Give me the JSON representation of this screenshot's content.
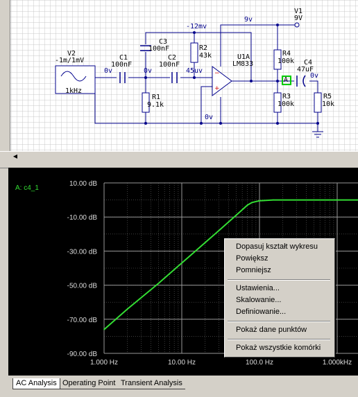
{
  "schematic": {
    "nets": {
      "minus12": "-12mv",
      "nine": "9v",
      "zero_a": "0v",
      "zero_b": "0v",
      "zero_c": "0v",
      "u45": "45uv",
      "zero_d": "0v",
      "zero_e": "0v"
    },
    "components": {
      "v1": {
        "name": "V1",
        "value": "9V"
      },
      "v2": {
        "name": "V2",
        "value": "-1m/1mV",
        "freq": "1kHz"
      },
      "c1": {
        "name": "C1",
        "value": "100nF"
      },
      "c2": {
        "name": "C2",
        "value": "100nF"
      },
      "c3": {
        "name": "C3",
        "value": "100nF"
      },
      "c4": {
        "name": "C4",
        "value": "47uF"
      },
      "r1": {
        "name": "R1",
        "value": "9.1k"
      },
      "r2": {
        "name": "R2",
        "value": "43k"
      },
      "r3": {
        "name": "R3",
        "value": "100k"
      },
      "r4": {
        "name": "R4",
        "value": "100k"
      },
      "r5": {
        "name": "R5",
        "value": "10k"
      },
      "u1": {
        "name": "U1A",
        "value": "LM833"
      },
      "probe": "A"
    }
  },
  "chart": {
    "trace_label": "A: c4_1",
    "colors": {
      "trace": "#33dd33",
      "axis_text": "#dddddd",
      "grid": "#666666",
      "background": "#000000"
    }
  },
  "chart_data": {
    "type": "line",
    "title": "",
    "xlabel": "",
    "ylabel": "",
    "xscale": "log",
    "xlim": [
      1,
      1000
    ],
    "ylim": [
      -90,
      10
    ],
    "x_tick_labels": [
      "1.000 Hz",
      "10.00 Hz",
      "100.0 Hz",
      "1.000kHz"
    ],
    "y_tick_labels": [
      "10.00 dB",
      "-10.00 dB",
      "-30.00 dB",
      "-50.00 dB",
      "-70.00 dB",
      "-90.00 dB"
    ],
    "series": [
      {
        "name": "A: c4_1",
        "x": [
          1,
          2,
          5,
          10,
          20,
          30,
          50,
          70,
          80,
          100,
          150,
          200,
          500,
          1000
        ],
        "y": [
          -76,
          -64,
          -49,
          -37,
          -25,
          -18,
          -9,
          -3,
          -1.5,
          -0.5,
          0,
          0,
          0,
          0
        ]
      }
    ]
  },
  "context_menu": {
    "items": [
      "Dopasuj kształt wykresu",
      "Powiększ",
      "Pomniejsz",
      "Ustawienia...",
      "Skalowanie...",
      "Definiowanie...",
      "Pokaż dane punktów",
      "Pokaż wszystkie komórki"
    ]
  },
  "tabs": [
    "AC Analysis",
    "Operating Point",
    "Transient Analysis"
  ]
}
